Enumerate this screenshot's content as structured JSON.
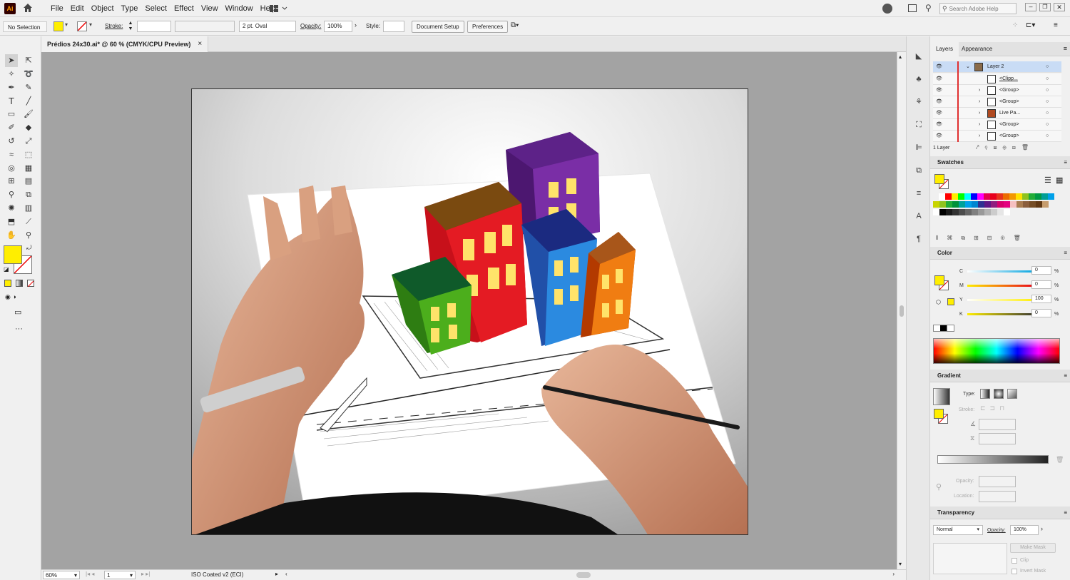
{
  "app": {
    "logo": "Ai"
  },
  "menu": [
    "File",
    "Edit",
    "Object",
    "Type",
    "Select",
    "Effect",
    "View",
    "Window",
    "Help"
  ],
  "search": {
    "placeholder": "Search Adobe Help"
  },
  "control": {
    "selection": "No Selection",
    "stroke_label": "Stroke:",
    "brush": "2 pt. Oval",
    "opacity_label": "Opacity:",
    "opacity_value": "100%",
    "style_label": "Style:",
    "doc_setup": "Document Setup",
    "preferences": "Preferences"
  },
  "document": {
    "tab_title": "Prédios 24x30.ai* @ 60 % (CMYK/CPU Preview)",
    "close": "×"
  },
  "status": {
    "zoom": "60%",
    "artboard": "1",
    "profile": "ISO Coated v2 (ECI)"
  },
  "colors": {
    "fill": "#ffee00",
    "canvas": "#a3a3a3",
    "selection": "#c9dcf5"
  },
  "layers_panel": {
    "tabs": [
      "Layers",
      "Appearance"
    ],
    "rows": [
      {
        "name": "Layer 2",
        "selected": true
      },
      {
        "name": "<Clipp...",
        "selected": false
      },
      {
        "name": "<Group>",
        "selected": false
      },
      {
        "name": "<Group>",
        "selected": false
      },
      {
        "name": "Live Pa...",
        "selected": false
      },
      {
        "name": "<Group>",
        "selected": false
      },
      {
        "name": "<Group>",
        "selected": false
      }
    ],
    "footer": "1 Layer"
  },
  "swatches_panel": {
    "title": "Swatches"
  },
  "color_panel": {
    "title": "Color",
    "channels": [
      {
        "label": "C",
        "value": "0"
      },
      {
        "label": "M",
        "value": "0"
      },
      {
        "label": "Y",
        "value": "100"
      },
      {
        "label": "K",
        "value": "0"
      }
    ],
    "unit": "%"
  },
  "gradient_panel": {
    "title": "Gradient",
    "type_label": "Type:",
    "stroke_label": "Stroke:",
    "opacity_label": "Opacity:",
    "location_label": "Location:"
  },
  "transparency_panel": {
    "title": "Transparency",
    "mode": "Normal",
    "opacity_label": "Opacity:",
    "opacity_value": "100%",
    "make_mask": "Make Mask",
    "clip": "Clip",
    "invert_mask": "Invert Mask"
  }
}
